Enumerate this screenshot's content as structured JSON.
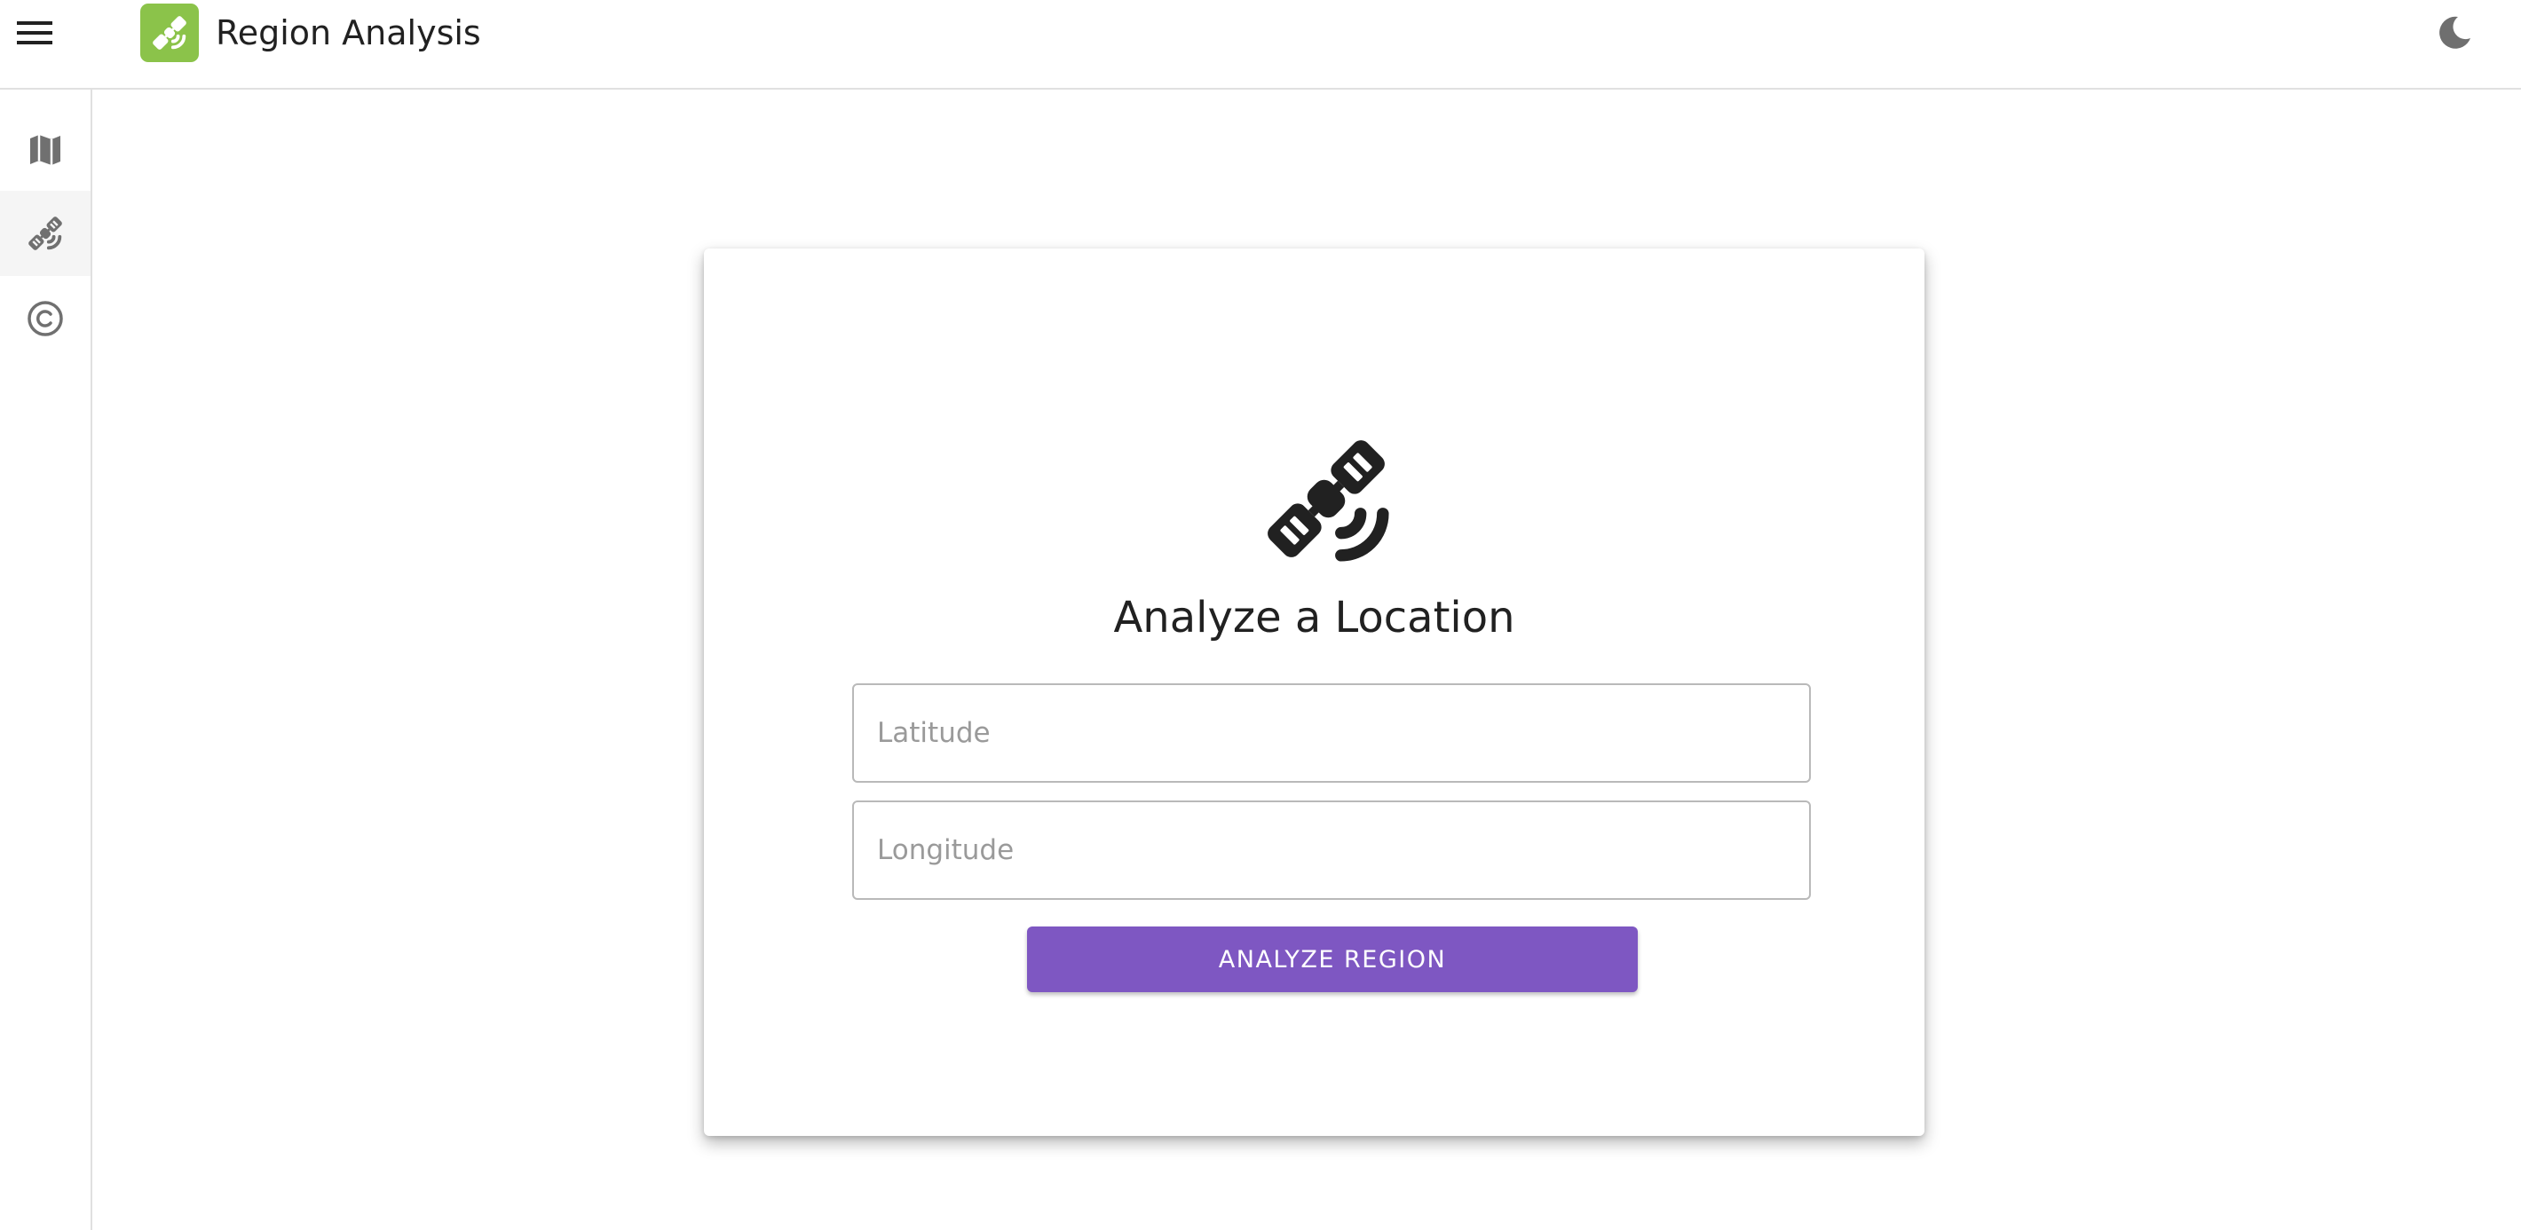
{
  "app": {
    "title": "Region Analysis",
    "logo_icon": "satellite-icon",
    "logo_color": "#8bc34a",
    "menu_icon": "hamburger-menu-icon",
    "theme_toggle_icon": "moon-icon"
  },
  "sidebar": {
    "items": [
      {
        "icon": "map-icon",
        "active": false
      },
      {
        "icon": "satellite-icon",
        "active": true
      },
      {
        "icon": "copyright-icon",
        "active": false
      }
    ]
  },
  "card": {
    "icon": "satellite-icon",
    "title": "Analyze a Location",
    "latitude": {
      "placeholder": "Latitude",
      "value": ""
    },
    "longitude": {
      "placeholder": "Longitude",
      "value": ""
    },
    "submit_label": "ANALYZE REGION",
    "accent_color": "#7e57c2"
  }
}
